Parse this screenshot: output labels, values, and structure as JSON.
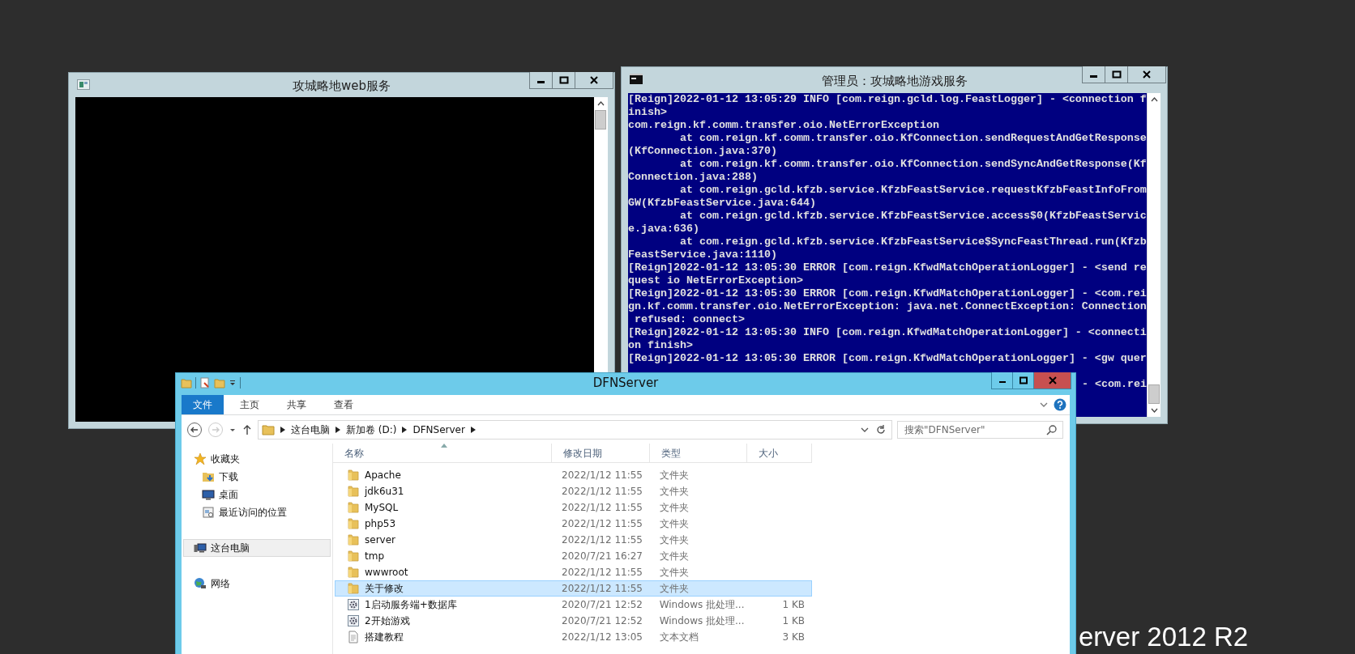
{
  "desktop": {
    "edition_text": "erver 2012 R2"
  },
  "web_window": {
    "title": "攻城略地web服务"
  },
  "console_window": {
    "title": "管理员：攻城略地游戏服务",
    "lines": [
      {
        "kind": "line",
        "text": "[Reign]2022-01-12 13:05:29 INFO [com.reign.gcld.log.FeastLogger] - <connection f"
      },
      {
        "kind": "line",
        "text": "inish>"
      },
      {
        "kind": "line",
        "text": "com.reign.kf.comm.transfer.oio.NetErrorException"
      },
      {
        "kind": "line",
        "text": "        at com.reign.kf.comm.transfer.oio.KfConnection.sendRequestAndGetResponse"
      },
      {
        "kind": "line",
        "text": "(KfConnection.java:370)"
      },
      {
        "kind": "line",
        "text": "        at com.reign.kf.comm.transfer.oio.KfConnection.sendSyncAndGetResponse(Kf"
      },
      {
        "kind": "line",
        "text": "Connection.java:288)"
      },
      {
        "kind": "line",
        "text": "        at com.reign.gcld.kfzb.service.KfzbFeastService.requestKfzbFeastInfoFrom"
      },
      {
        "kind": "line",
        "text": "GW(KfzbFeastService.java:644)"
      },
      {
        "kind": "line",
        "text": "        at com.reign.gcld.kfzb.service.KfzbFeastService.access$0(KfzbFeastServic"
      },
      {
        "kind": "line",
        "text": "e.java:636)"
      },
      {
        "kind": "line",
        "text": "        at com.reign.gcld.kfzb.service.KfzbFeastService$SyncFeastThread.run(Kfzb"
      },
      {
        "kind": "line",
        "text": "FeastService.java:1110)"
      },
      {
        "kind": "line",
        "text": "[Reign]2022-01-12 13:05:30 ERROR [com.reign.KfwdMatchOperationLogger] - <send re"
      },
      {
        "kind": "line",
        "text": "quest io NetErrorException>"
      },
      {
        "kind": "line",
        "text": "[Reign]2022-01-12 13:05:30 ERROR [com.reign.KfwdMatchOperationLogger] - <com.rei"
      },
      {
        "kind": "line",
        "text": "gn.kf.comm.transfer.oio.NetErrorException: java.net.ConnectException: Connection"
      },
      {
        "kind": "line",
        "text": " refused: connect>"
      },
      {
        "kind": "line",
        "text": "[Reign]2022-01-12 13:05:30 INFO [com.reign.KfwdMatchOperationLogger] - <connecti"
      },
      {
        "kind": "line",
        "text": "on finish>"
      },
      {
        "kind": "line",
        "text": "[Reign]2022-01-12 13:05:30 ERROR [com.reign.KfwdMatchOperationLogger] - <gw quer"
      },
      {
        "kind": "covered"
      },
      {
        "kind": "tail",
        "text": "- <com.rei"
      }
    ]
  },
  "explorer": {
    "title": "DFNServer",
    "ribbon_tabs": [
      {
        "kind": "file",
        "label": "文件"
      },
      {
        "kind": "tab",
        "label": "主页"
      },
      {
        "kind": "tab",
        "label": "共享"
      },
      {
        "kind": "tab",
        "label": "查看"
      }
    ],
    "breadcrumb": [
      "这台电脑",
      "新加卷 (D:)",
      "DFNServer"
    ],
    "search": {
      "placeholder": "搜索\"DFNServer\""
    },
    "nav": [
      {
        "kind": "favorites",
        "label": "收藏夹",
        "selected": false,
        "children": [
          {
            "kind": "downloads",
            "label": "下载",
            "selected": false
          },
          {
            "kind": "desktop",
            "label": "桌面",
            "selected": false
          },
          {
            "kind": "recent",
            "label": "最近访问的位置",
            "selected": false
          }
        ]
      },
      {
        "kind": "computer",
        "label": "这台电脑",
        "selected": true
      },
      {
        "kind": "network",
        "label": "网络",
        "selected": false
      }
    ],
    "columns": [
      "名称",
      "修改日期",
      "类型",
      "大小"
    ],
    "files": [
      {
        "kind": "folder",
        "name": "Apache",
        "modified": "2022/1/12 11:55",
        "type": "文件夹",
        "selected": false
      },
      {
        "kind": "folder",
        "name": "jdk6u31",
        "modified": "2022/1/12 11:55",
        "type": "文件夹",
        "selected": false
      },
      {
        "kind": "folder",
        "name": "MySQL",
        "modified": "2022/1/12 11:55",
        "type": "文件夹",
        "selected": false
      },
      {
        "kind": "folder",
        "name": "php53",
        "modified": "2022/1/12 11:55",
        "type": "文件夹",
        "selected": false
      },
      {
        "kind": "folder",
        "name": "server",
        "modified": "2022/1/12 11:55",
        "type": "文件夹",
        "selected": false
      },
      {
        "kind": "folder",
        "name": "tmp",
        "modified": "2020/7/21 16:27",
        "type": "文件夹",
        "selected": false
      },
      {
        "kind": "folder",
        "name": "wwwroot",
        "modified": "2022/1/12 11:55",
        "type": "文件夹",
        "selected": false
      },
      {
        "kind": "folder",
        "name": "关于修改",
        "modified": "2022/1/12 11:55",
        "type": "文件夹",
        "selected": true
      },
      {
        "kind": "batch",
        "name": "1启动服务端+数据库",
        "modified": "2020/7/21 12:52",
        "type": "Windows 批处理...",
        "size": "1 KB",
        "selected": false
      },
      {
        "kind": "batch",
        "name": "2开始游戏",
        "modified": "2020/7/21 12:52",
        "type": "Windows 批处理...",
        "size": "1 KB",
        "selected": false
      },
      {
        "kind": "text",
        "name": "搭建教程",
        "modified": "2022/1/12 13:05",
        "type": "文本文档",
        "size": "3 KB",
        "selected": false
      }
    ]
  }
}
